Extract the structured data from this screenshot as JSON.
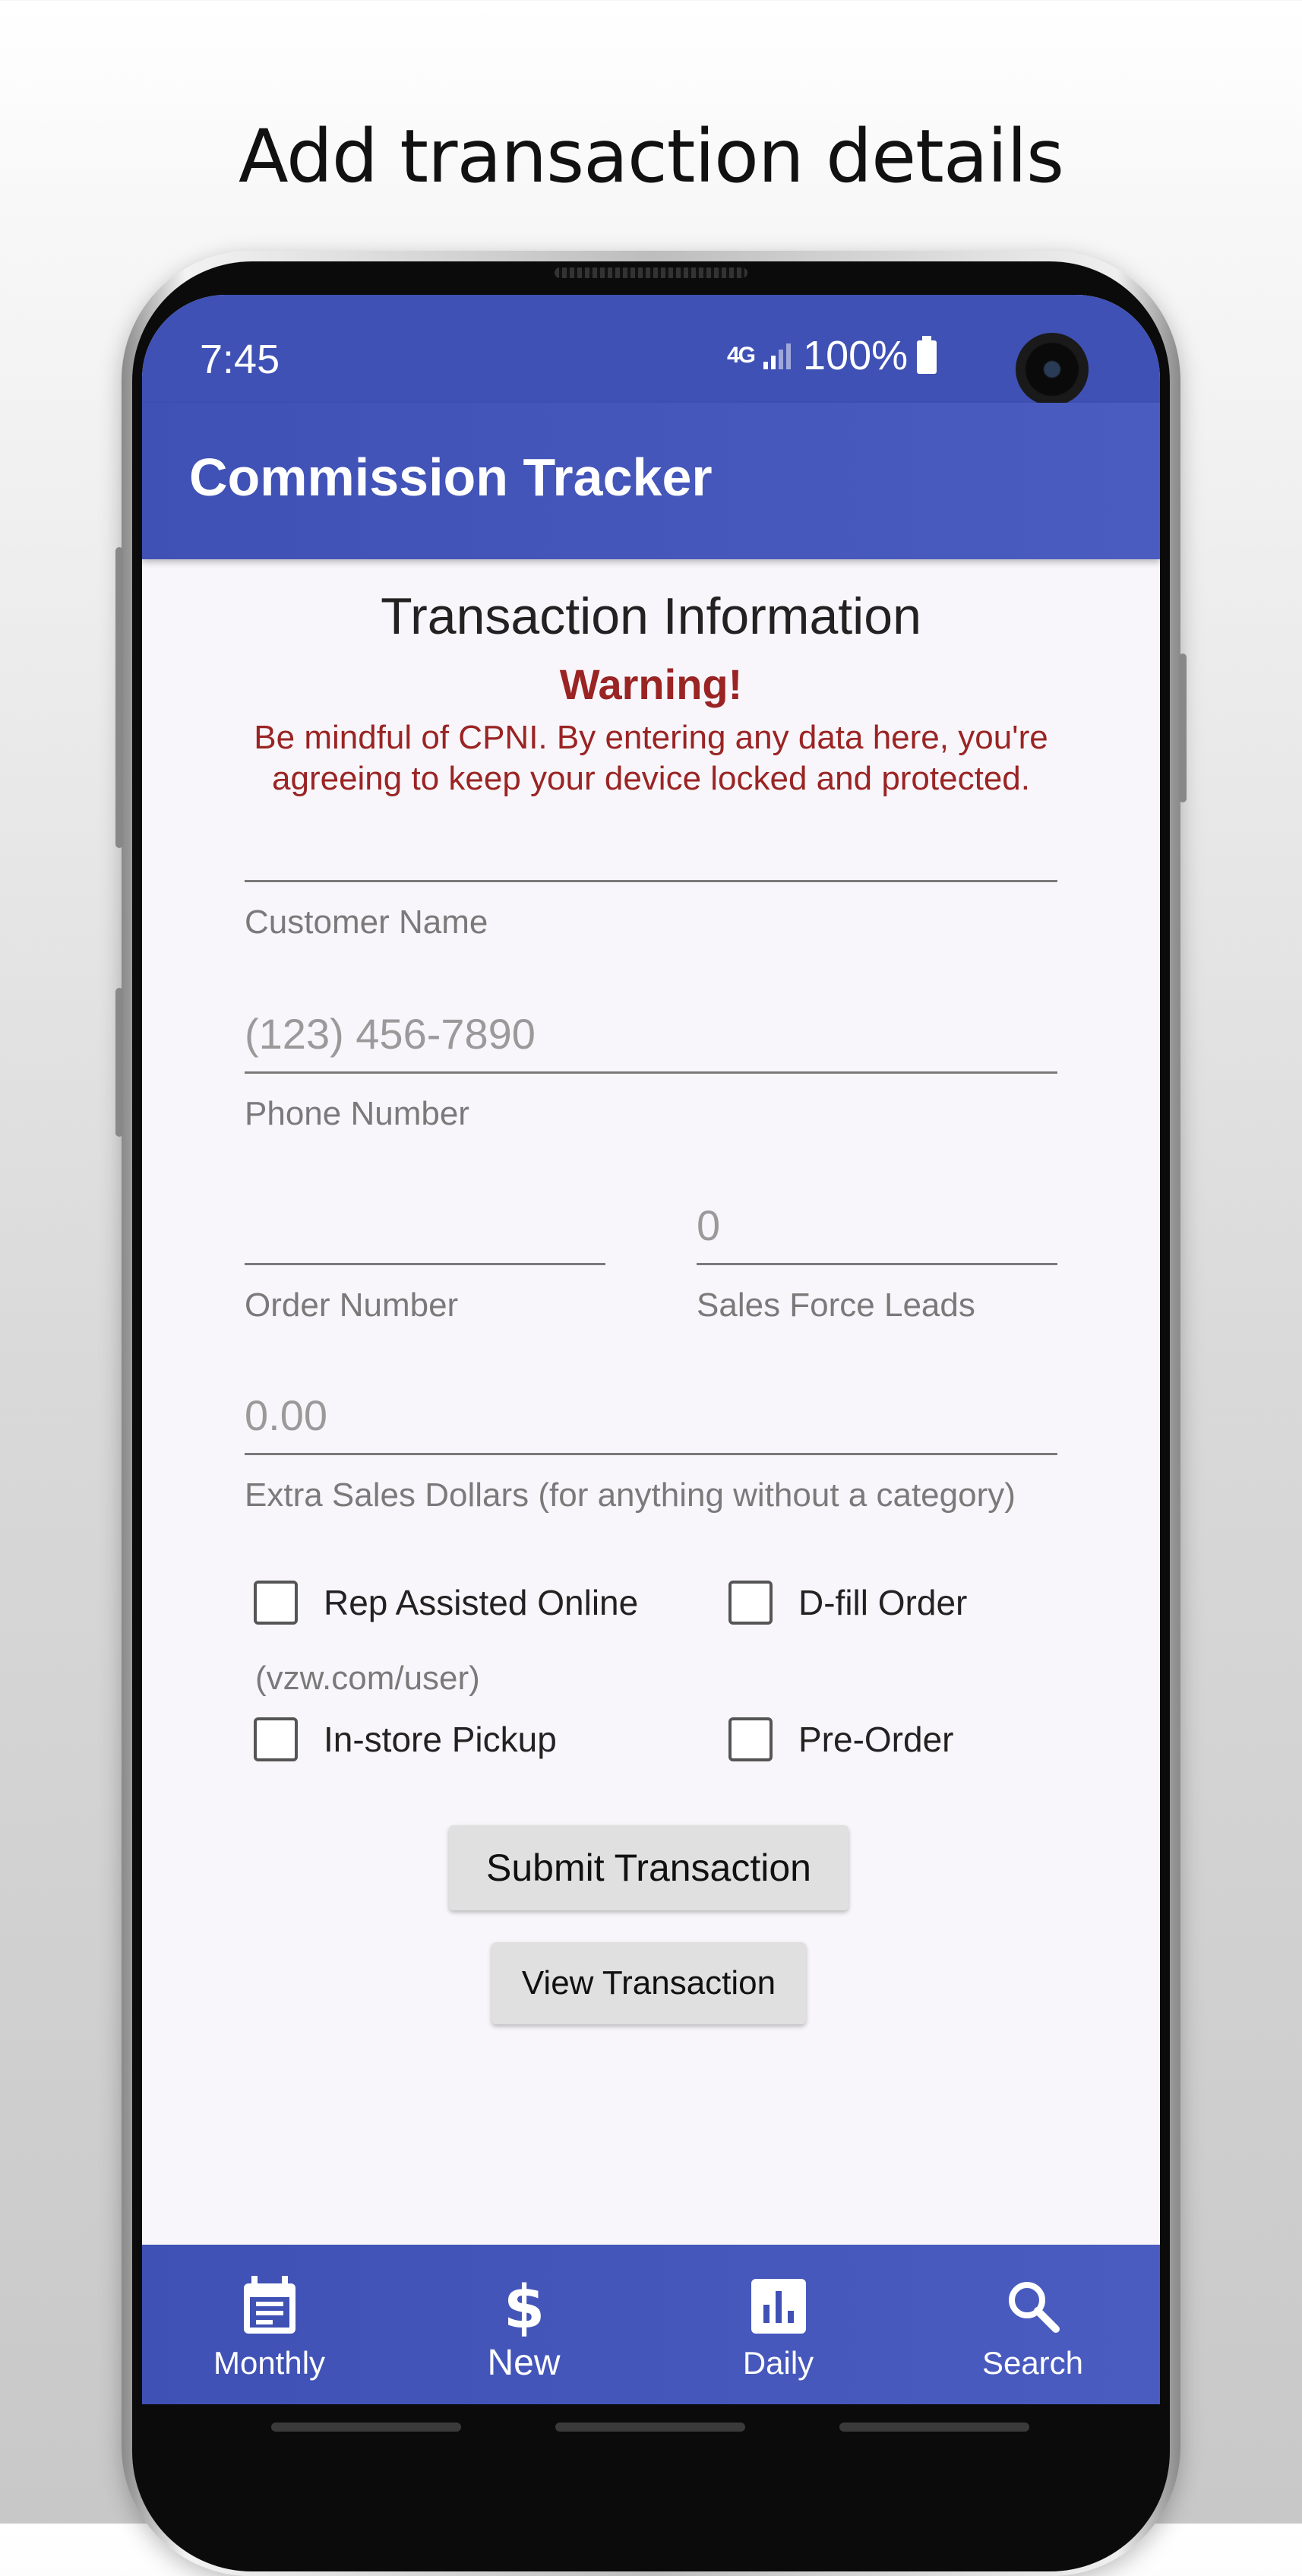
{
  "headline": "Add transaction details",
  "status_bar": {
    "time": "7:45",
    "network": "4G",
    "battery": "100%"
  },
  "app_bar": {
    "title": "Commission Tracker"
  },
  "form": {
    "section_title": "Transaction Information",
    "warning_title": "Warning!",
    "warning_text": "Be mindful of CPNI. By entering any data here, you're agreeing to keep your device locked and protected.",
    "customer_name": {
      "label": "Customer Name",
      "value": "",
      "placeholder": ""
    },
    "phone_number": {
      "label": "Phone Number",
      "value": "",
      "placeholder": "(123) 456-7890"
    },
    "order_number": {
      "label": "Order Number",
      "value": "",
      "placeholder": ""
    },
    "sales_force_leads": {
      "label": "Sales Force Leads",
      "value": "",
      "placeholder": "0"
    },
    "extra_sales": {
      "label": "Extra Sales Dollars (for anything without a category)",
      "value": "",
      "placeholder": "0.00"
    },
    "checkboxes": {
      "rep_assisted": {
        "label": "Rep Assisted Online",
        "sublabel": "(vzw.com/user)",
        "checked": false
      },
      "dfill": {
        "label": "D-fill Order",
        "checked": false
      },
      "instore": {
        "label": "In-store Pickup",
        "checked": false
      },
      "preorder": {
        "label": "Pre-Order",
        "checked": false
      }
    },
    "submit_label": "Submit Transaction",
    "view_label": "View Transaction"
  },
  "bottom_nav": {
    "items": [
      {
        "label": "Monthly",
        "icon": "calendar-icon"
      },
      {
        "label": "New",
        "icon": "dollar-icon"
      },
      {
        "label": "Daily",
        "icon": "bar-chart-icon"
      },
      {
        "label": "Search",
        "icon": "search-icon"
      }
    ],
    "active": "New"
  },
  "colors": {
    "primary": "#3f51b5",
    "warning": "#9a2424",
    "background": "#f8f6fa"
  }
}
